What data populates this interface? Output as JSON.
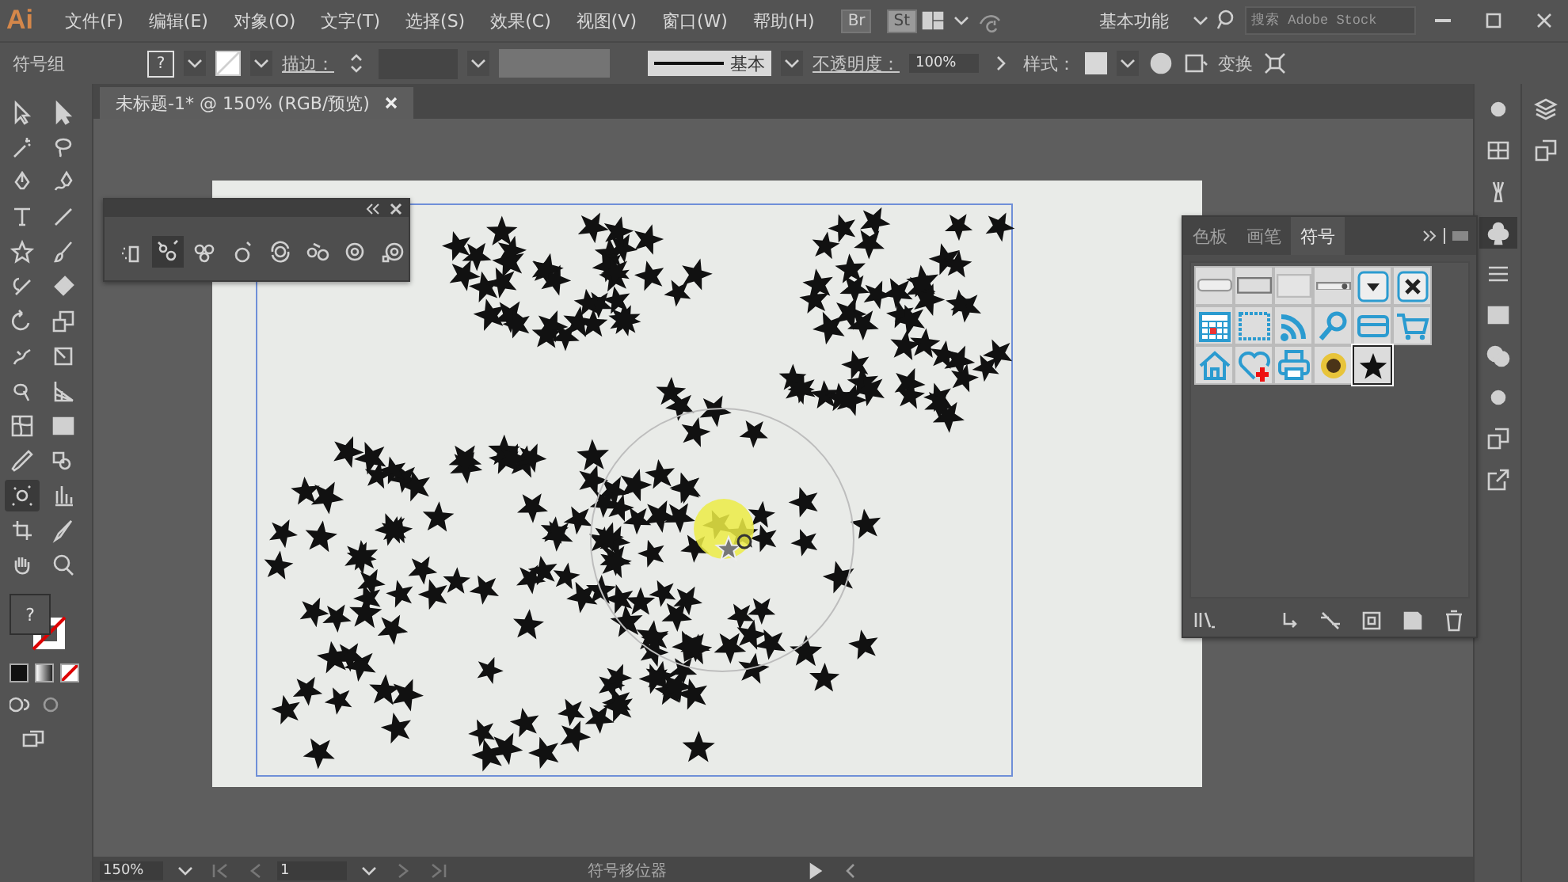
{
  "app": {
    "logo": "Ai",
    "bridge": "Br",
    "stock": "St"
  },
  "menu": [
    "文件(F)",
    "编辑(E)",
    "对象(O)",
    "文字(T)",
    "选择(S)",
    "效果(C)",
    "视图(V)",
    "窗口(W)",
    "帮助(H)"
  ],
  "title_bar": {
    "workspace": "基本功能",
    "search_placeholder": "搜索 Adobe Stock"
  },
  "control_bar": {
    "selection_label": "符号组",
    "fill_swatch": "?",
    "stroke_label": "描边：",
    "stroke_profile": "基本",
    "opacity_label": "不透明度：",
    "opacity_value": "100%",
    "style_label": "样式：",
    "transform": "变换"
  },
  "document_tab": {
    "title": "未标题-1* @ 150% (RGB/预览)"
  },
  "tools": [
    {
      "kind": "selection",
      "selected": false
    },
    {
      "kind": "direct-selection",
      "selected": false
    },
    {
      "kind": "magic-wand",
      "selected": false
    },
    {
      "kind": "lasso",
      "selected": false
    },
    {
      "kind": "pen",
      "selected": false
    },
    {
      "kind": "curvature",
      "selected": false
    },
    {
      "kind": "type",
      "selected": false
    },
    {
      "kind": "line",
      "selected": false
    },
    {
      "kind": "star",
      "selected": false
    },
    {
      "kind": "brush",
      "selected": false
    },
    {
      "kind": "shaper",
      "selected": false
    },
    {
      "kind": "eraser",
      "selected": false
    },
    {
      "kind": "rotate",
      "selected": false
    },
    {
      "kind": "scale",
      "selected": false
    },
    {
      "kind": "warp",
      "selected": false
    },
    {
      "kind": "free-transform",
      "selected": false
    },
    {
      "kind": "shape-builder",
      "selected": false
    },
    {
      "kind": "perspective",
      "selected": false
    },
    {
      "kind": "mesh",
      "selected": false
    },
    {
      "kind": "gradient",
      "selected": false
    },
    {
      "kind": "eyedropper",
      "selected": false
    },
    {
      "kind": "blend",
      "selected": false
    },
    {
      "kind": "symbol-sprayer",
      "selected": true
    },
    {
      "kind": "graph",
      "selected": false
    },
    {
      "kind": "artboard",
      "selected": false
    },
    {
      "kind": "knife",
      "selected": false
    },
    {
      "kind": "hand",
      "selected": false
    },
    {
      "kind": "zoom",
      "selected": false
    }
  ],
  "fill_stroke": {
    "fill_swatch": "?"
  },
  "symbolism_panel": {
    "tools": [
      {
        "kind": "sprayer",
        "selected": false
      },
      {
        "kind": "shifter",
        "selected": true
      },
      {
        "kind": "scruncher",
        "selected": false
      },
      {
        "kind": "sizer",
        "selected": false
      },
      {
        "kind": "spinner",
        "selected": false
      },
      {
        "kind": "stainer",
        "selected": false
      },
      {
        "kind": "screener",
        "selected": false
      },
      {
        "kind": "styler",
        "selected": false
      }
    ]
  },
  "symbols_panel": {
    "tabs": [
      {
        "label": "色板",
        "selected": false
      },
      {
        "label": "画笔",
        "selected": false
      },
      {
        "label": "符号",
        "selected": true
      }
    ],
    "items": [
      {
        "kind": "button-wide",
        "selected": false
      },
      {
        "kind": "button-bar",
        "selected": false
      },
      {
        "kind": "button-plain",
        "selected": false
      },
      {
        "kind": "slider",
        "selected": false
      },
      {
        "kind": "dropdown",
        "selected": false
      },
      {
        "kind": "close",
        "selected": false
      },
      {
        "kind": "calendar",
        "selected": false
      },
      {
        "kind": "film",
        "selected": false
      },
      {
        "kind": "rss",
        "selected": false
      },
      {
        "kind": "search",
        "selected": false
      },
      {
        "kind": "card",
        "selected": false
      },
      {
        "kind": "cart",
        "selected": false
      },
      {
        "kind": "home",
        "selected": false
      },
      {
        "kind": "heart-plus",
        "selected": false
      },
      {
        "kind": "printer",
        "selected": false
      },
      {
        "kind": "flower",
        "selected": false
      },
      {
        "kind": "star",
        "selected": true
      }
    ]
  },
  "dock": [
    {
      "kind": "sun",
      "selected": false
    },
    {
      "kind": "grid",
      "selected": false
    },
    {
      "kind": "brush",
      "selected": false
    },
    {
      "kind": "club",
      "selected": true
    },
    {
      "kind": "lines",
      "selected": false
    },
    {
      "kind": "gradient",
      "selected": false
    },
    {
      "kind": "circles",
      "selected": false
    },
    {
      "kind": "sun",
      "selected": false
    },
    {
      "kind": "squares",
      "selected": false
    },
    {
      "kind": "export",
      "selected": false
    },
    {
      "kind": "layers",
      "selected": false
    },
    {
      "kind": "squares",
      "selected": false
    }
  ],
  "status_bar": {
    "zoom": "150%",
    "page": "1",
    "tool_name": "符号移位器"
  }
}
